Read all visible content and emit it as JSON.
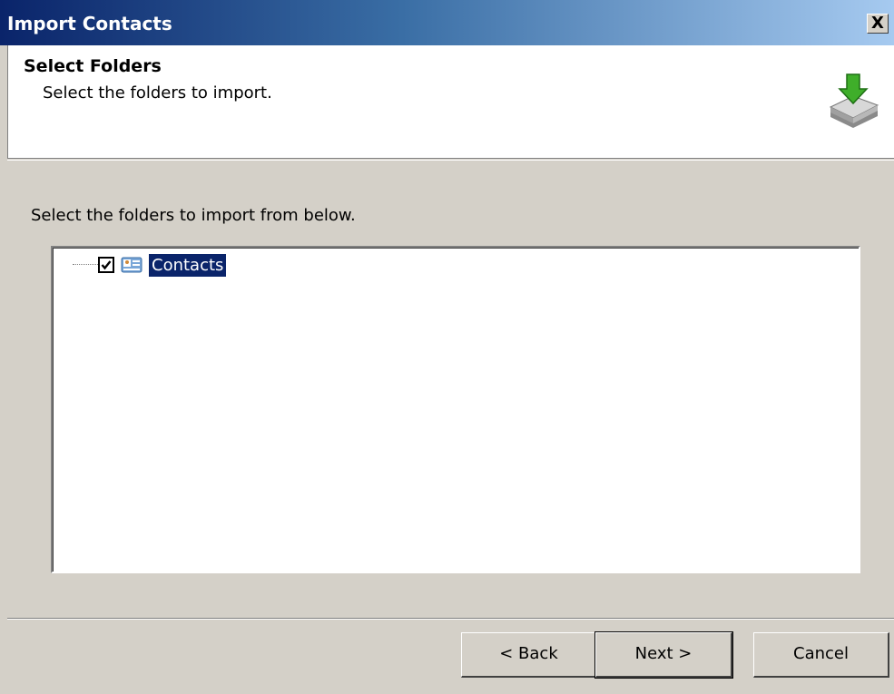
{
  "window": {
    "title": "Import Contacts",
    "close_glyph": "X"
  },
  "header": {
    "title": "Select Folders",
    "subtitle": "Select the folders to import.",
    "icon": "import-tray-arrow-icon"
  },
  "body": {
    "instruction": "Select the folders to import from below."
  },
  "tree": {
    "items": [
      {
        "label": "Contacts",
        "checked": true,
        "selected": true,
        "icon": "contacts-folder-icon"
      }
    ]
  },
  "buttons": {
    "back": "< Back",
    "next": "Next >",
    "cancel": "Cancel"
  },
  "colors": {
    "titlebar_start": "#0a246a",
    "titlebar_end": "#a6caf0",
    "selection": "#0a246a",
    "dialog_bg": "#d4d0c8"
  }
}
